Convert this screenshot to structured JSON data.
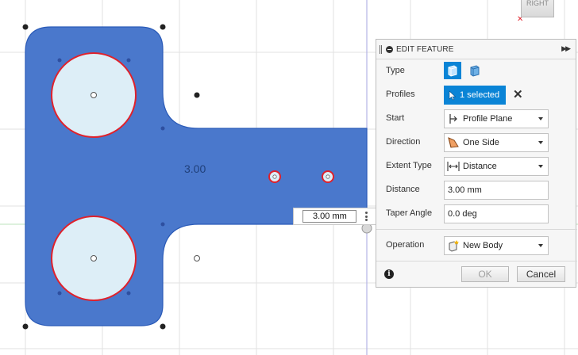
{
  "canvas": {
    "sketch_dimension": "3.00",
    "dimension_input_value": "3.00 mm",
    "viewcube_label": "RIGHT",
    "colors": {
      "body_fill": "#4a78cc",
      "body_edge": "#2b5bb8",
      "hole_fill": "#ddeef7",
      "hole_edge": "#e0212b",
      "grid_line": "#e2e2e2",
      "axis_line": "#b4b4e6"
    }
  },
  "panel": {
    "title": "EDIT FEATURE",
    "type_label": "Type",
    "type_icons": [
      "extrude-solid-icon",
      "extrude-thin-icon"
    ],
    "profiles_label": "Profiles",
    "profiles_value": "1 selected",
    "start_label": "Start",
    "start_value": "Profile Plane",
    "direction_label": "Direction",
    "direction_value": "One Side",
    "extent_label": "Extent Type",
    "extent_value": "Distance",
    "distance_label": "Distance",
    "distance_value": "3.00 mm",
    "taper_label": "Taper Angle",
    "taper_value": "0.0 deg",
    "operation_label": "Operation",
    "operation_value": "New Body",
    "ok_label": "OK",
    "cancel_label": "Cancel",
    "accent_color": "#0a84d6"
  }
}
